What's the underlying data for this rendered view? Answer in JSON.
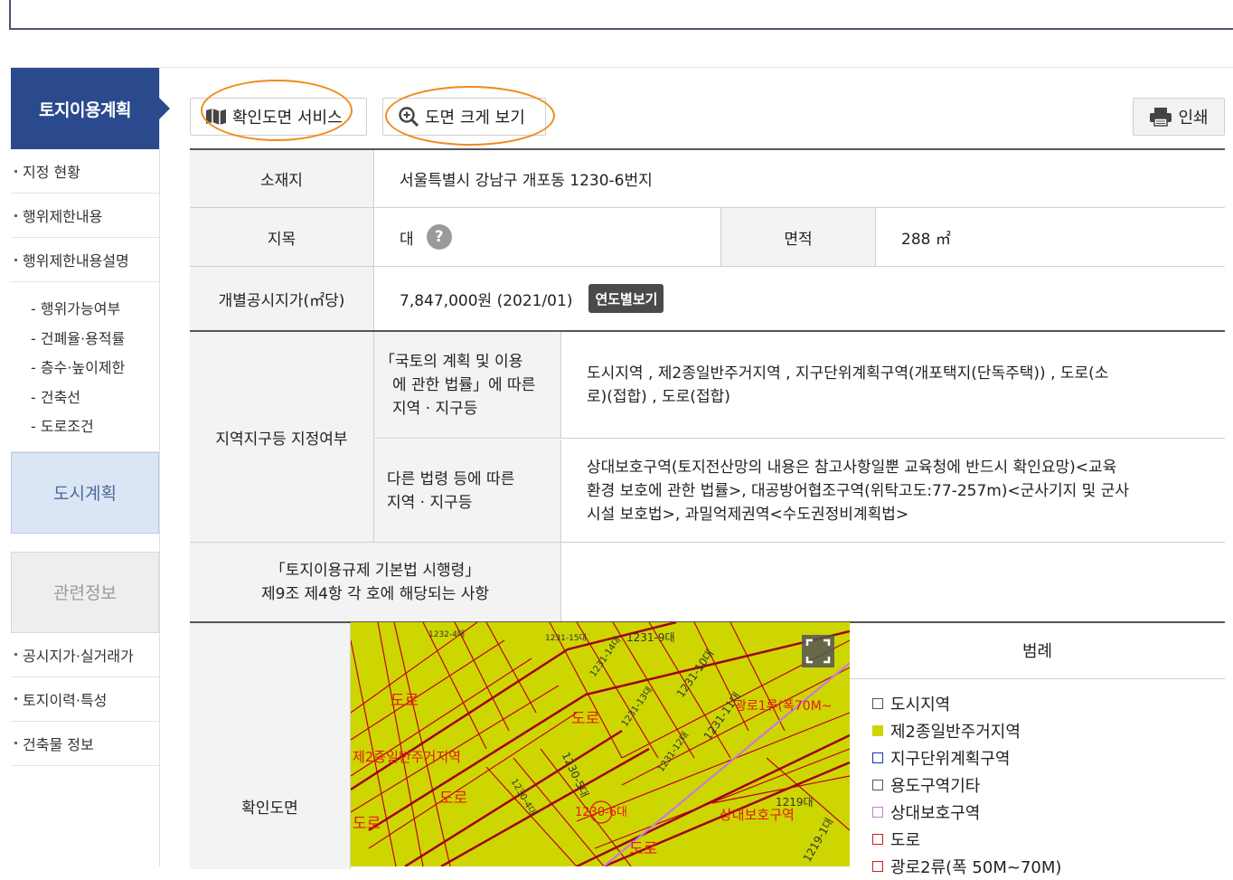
{
  "sidebar": {
    "title": "토지이용계획",
    "items": [
      {
        "label": "지정 현황"
      },
      {
        "label": "행위제한내용"
      },
      {
        "label": "행위제한내용설명"
      }
    ],
    "subitems": [
      {
        "label": "- 행위가능여부"
      },
      {
        "label": "- 건폐율·용적률"
      },
      {
        "label": "- 층수·높이제한"
      },
      {
        "label": "- 건축선"
      },
      {
        "label": "- 도로조건"
      }
    ],
    "city_plan": "도시계획",
    "related": "관련정보",
    "bottom_items": [
      {
        "label": "공시지가·실거래가"
      },
      {
        "label": "토지이력·특성"
      },
      {
        "label": "건축물 정보"
      }
    ]
  },
  "toolbar": {
    "confirm_map_service": "확인도면 서비스",
    "view_map_large": "도면 크게 보기",
    "print": "인쇄"
  },
  "table": {
    "location_label": "소재지",
    "location_value": "서울특별시 강남구 개포동 1230-6번지",
    "land_category_label": "지목",
    "land_category_value": "대",
    "help_glyph": "?",
    "area_label": "면적",
    "area_value": "288 ㎡",
    "price_label": "개별공시지가(㎡당)",
    "price_value": "7,847,000원 (2021/01)",
    "year_button": "연도별보기",
    "zone_label": "지역지구등 지정여부",
    "zone_law1_label_l1": "「국토의 계획 및 이용",
    "zone_law1_label_l2": "에 관한 법률」에 따른",
    "zone_law1_label_l3": "지역 · 지구등",
    "zone_law1_value_l1": "도시지역 , 제2종일반주거지역 , 지구단위계획구역(개포택지(단독주택)) , 도로(소",
    "zone_law1_value_l2": "로)(접합) , 도로(접합)",
    "zone_law2_label_l1": "다른 법령 등에 따른",
    "zone_law2_label_l2": "지역 · 지구등",
    "zone_law2_value_l1": "상대보호구역(토지전산망의 내용은 참고사항일뿐 교육청에 반드시 확인요망)<교육",
    "zone_law2_value_l2": "환경 보호에 관한 법률>, 대공방어협조구역(위탁고도:77-257m)<군사기지 및 군사",
    "zone_law2_value_l3": "시설 보호법>, 과밀억제권역<수도권정비계획법>",
    "decree_label_l1": "「토지이용규제 기본법 시행령」",
    "decree_label_l2": "제9조 제4항 각 호에 해당되는 사항",
    "decree_value": "",
    "map_label": "확인도면"
  },
  "map_labels": {
    "road1": "도로",
    "road2": "도로",
    "road3": "도로",
    "road4": "도로",
    "road5": "도로",
    "zone2": "제2종일반주거지역",
    "plot": "1230-6대",
    "wide_road": "광로1류(폭70M~",
    "protect": "상대보호구역",
    "lot_1231_9": "1231-9대",
    "lot_1231_10": "1231-10대",
    "lot_1231_11": "1231-11대",
    "lot_1219": "1219대",
    "lot_1219_1": "1219-1대",
    "lot_1230_5": "1230-5대",
    "lot_1231_15": "1231-15대",
    "lot_1232_4": "1232-4대",
    "lot_1231_14": "1231-14대",
    "lot_1231_13": "1231-13대",
    "lot_1231_12": "1231-12대",
    "lot_1230_4": "1230-4대"
  },
  "legend": {
    "title": "범례",
    "items": [
      {
        "label": "도시지역",
        "color": "#555555",
        "fill": "#ffffff"
      },
      {
        "label": "제2종일반주거지역",
        "color": "#cdd600",
        "fill": "#cdd600"
      },
      {
        "label": "지구단위계획구역",
        "color": "#1a2bb8",
        "fill": "#ffffff"
      },
      {
        "label": "용도구역기타",
        "color": "#555555",
        "fill": "#ffffff"
      },
      {
        "label": "상대보호구역",
        "color": "#c97ad8",
        "fill": "#ffffff"
      },
      {
        "label": "도로",
        "color": "#d71a1a",
        "fill": "#ffffff"
      },
      {
        "label": "광로2류(폭 50M~70M)",
        "color": "#d71a1a",
        "fill": "#ffffff"
      }
    ]
  },
  "colors": {
    "sidebar_header": "#2b4a8e",
    "highlight_oval": "#f08a1c",
    "map_zone": "#cdd600",
    "map_line": "#c0001a"
  },
  "icons": {
    "map": "map-icon",
    "zoom": "zoom-in-icon",
    "print": "printer-icon",
    "fullscreen": "fullscreen-icon"
  }
}
